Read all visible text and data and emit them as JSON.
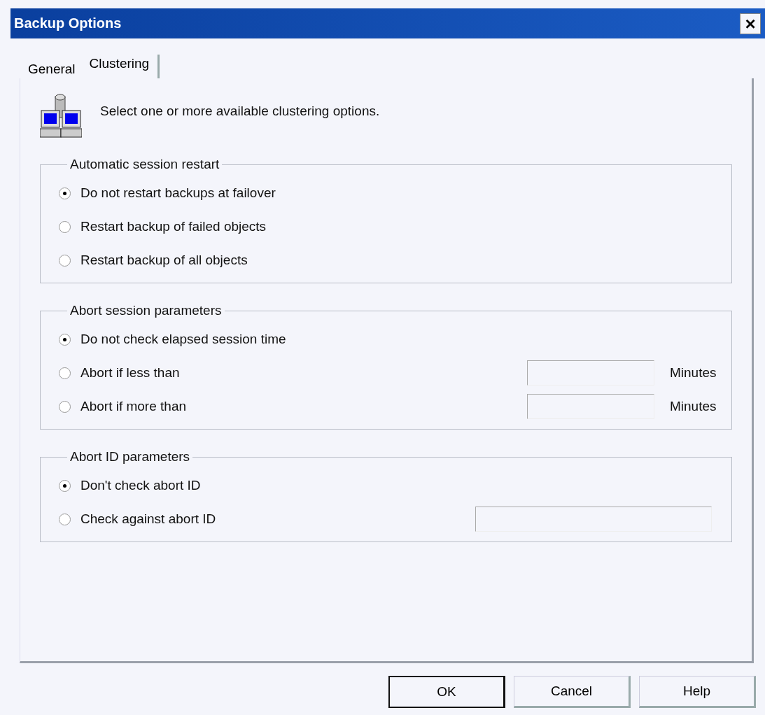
{
  "window": {
    "title": "Backup Options",
    "close": "×"
  },
  "tabs": [
    {
      "label": "General",
      "selected": false
    },
    {
      "label": "Clustering",
      "selected": true
    }
  ],
  "intro": "Select one or more available clustering options.",
  "groups": [
    {
      "title": "Automatic session restart",
      "options": [
        {
          "kind": "radio",
          "label": "Do not restart backups at failover",
          "selected": true
        },
        {
          "kind": "radio",
          "label": "Restart backup of failed objects",
          "selected": false
        },
        {
          "kind": "radio",
          "label": "Restart backup of all objects",
          "selected": false
        }
      ]
    },
    {
      "title": "Abort session parameters",
      "options": [
        {
          "kind": "radio",
          "label": "Do not check elapsed session time",
          "selected": true
        },
        {
          "kind": "radio-field",
          "label": "Abort if less than",
          "selected": false,
          "unit": "Minutes"
        },
        {
          "kind": "radio-field",
          "label": "Abort if more than",
          "selected": false,
          "unit": "Minutes"
        }
      ]
    },
    {
      "title": "Abort ID parameters",
      "options": [
        {
          "kind": "radio",
          "label": "Don't check abort ID",
          "selected": true
        },
        {
          "kind": "radio-wide-field",
          "label": "Check against abort ID",
          "selected": false
        }
      ]
    }
  ],
  "buttons": [
    {
      "label": "OK",
      "default": true
    },
    {
      "label": "Cancel",
      "default": false
    },
    {
      "label": "Help",
      "default": false
    }
  ]
}
